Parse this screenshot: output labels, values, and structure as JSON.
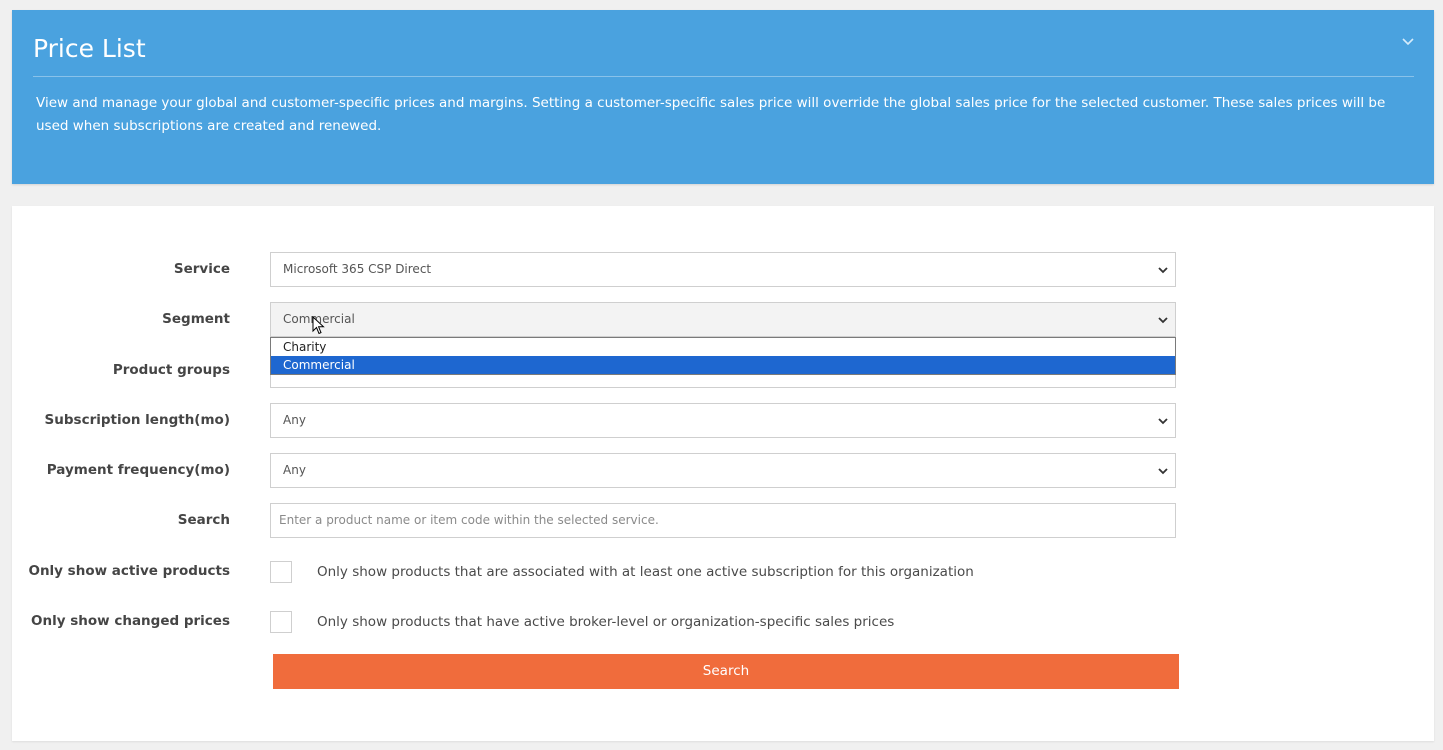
{
  "banner": {
    "title": "Price List",
    "description": "View and manage your global and customer-specific prices and margins. Setting a customer-specific sales price will override the global sales price for the selected customer. These sales prices will be used when subscriptions are created and renewed.",
    "collapse_icon": "chevron-down-icon",
    "color": "#4aa2df"
  },
  "form": {
    "service": {
      "label": "Service",
      "value": "Microsoft 365 CSP Direct"
    },
    "segment": {
      "label": "Segment",
      "value": "Commercial",
      "options": [
        "Charity",
        "Commercial"
      ],
      "highlighted": "Commercial"
    },
    "product_groups": {
      "label": "Product groups"
    },
    "subscription_length": {
      "label": "Subscription length(mo)",
      "value": "Any"
    },
    "payment_frequency": {
      "label": "Payment frequency(mo)",
      "value": "Any"
    },
    "search": {
      "label": "Search",
      "placeholder": "Enter a product name or item code within the selected service."
    },
    "only_active": {
      "label": "Only show active products",
      "text": "Only show products that are associated with at least one active subscription for this organization",
      "checked": false
    },
    "only_changed": {
      "label": "Only show changed prices",
      "text": "Only show products that have active broker-level or organization-specific sales prices",
      "checked": false
    },
    "search_button": {
      "label": "Search",
      "color": "#f06c3c"
    }
  }
}
